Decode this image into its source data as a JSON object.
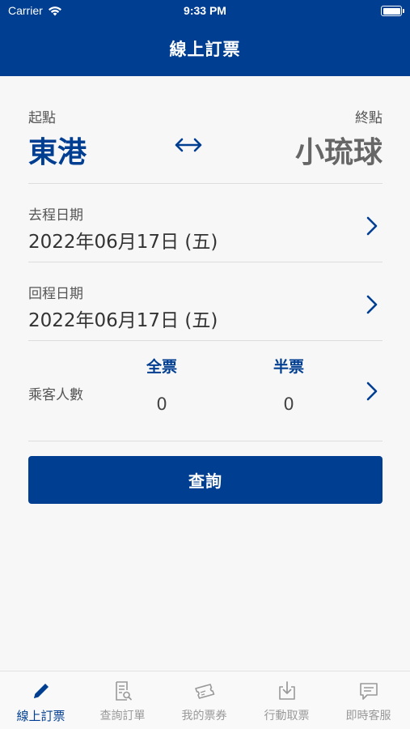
{
  "status_bar": {
    "carrier": "Carrier",
    "time": "9:33 PM"
  },
  "nav": {
    "title": "線上訂票"
  },
  "route": {
    "from_label": "起點",
    "from_value": "東港",
    "to_label": "終點",
    "to_value": "小琉球",
    "swap_icon": "swap-arrows-icon"
  },
  "departure": {
    "label": "去程日期",
    "value": "2022年06月17日 (五)"
  },
  "return": {
    "label": "回程日期",
    "value": "2022年06月17日 (五)"
  },
  "passengers": {
    "label": "乘客人數",
    "full_label": "全票",
    "full_count": "0",
    "half_label": "半票",
    "half_count": "0"
  },
  "query_button": "查詢",
  "tabs": [
    {
      "label": "線上訂票",
      "icon": "pencil-icon",
      "active": true
    },
    {
      "label": "查詢訂單",
      "icon": "document-search-icon",
      "active": false
    },
    {
      "label": "我的票券",
      "icon": "ticket-icon",
      "active": false
    },
    {
      "label": "行動取票",
      "icon": "download-icon",
      "active": false
    },
    {
      "label": "即時客服",
      "icon": "chat-icon",
      "active": false
    }
  ],
  "colors": {
    "primary": "#003e91",
    "inactive": "#999999",
    "background": "#f7f7f7"
  }
}
